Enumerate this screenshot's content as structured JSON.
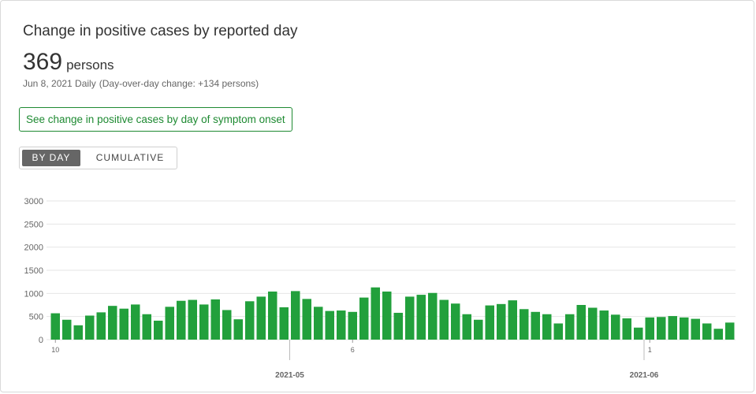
{
  "header": {
    "title": "Change in positive cases by reported day",
    "value": "369",
    "unit": "persons",
    "date_line": "Jun 8, 2021 Daily",
    "change_line": "(Day-over-day change: +134 persons)"
  },
  "link_button": {
    "label": "See change in positive cases by day of symptom onset"
  },
  "toggle": {
    "by_day": "BY DAY",
    "cumulative": "CUMULATIVE",
    "selected": "BY DAY"
  },
  "colors": {
    "bar": "#22a03c",
    "link": "#1e8a32",
    "grid": "#e6e6e6"
  },
  "chart_data": {
    "type": "bar",
    "x_start": "2021-04-10",
    "x_end": "2021-06-08",
    "x_ticks": [
      {
        "date": "2021-04-10",
        "label": "10",
        "kind": "day"
      },
      {
        "date": "2021-05-06",
        "label": "6",
        "kind": "day"
      },
      {
        "date": "2021-06-01",
        "label": "1",
        "kind": "day"
      },
      {
        "date": "2021-05-01",
        "label": "2021-05",
        "kind": "month"
      },
      {
        "date": "2021-06-01",
        "label": "2021-06",
        "kind": "month"
      }
    ],
    "y_ticks": [
      0,
      500,
      1000,
      1500,
      2000,
      2500,
      3000
    ],
    "ylim": [
      0,
      3000
    ],
    "grid": true,
    "values": [
      570,
      430,
      310,
      520,
      590,
      730,
      670,
      760,
      550,
      410,
      710,
      840,
      860,
      760,
      870,
      640,
      440,
      830,
      930,
      1040,
      700,
      1050,
      880,
      710,
      620,
      630,
      600,
      910,
      1130,
      1040,
      580,
      930,
      970,
      1010,
      860,
      780,
      550,
      430,
      740,
      770,
      850,
      660,
      600,
      550,
      350,
      550,
      750,
      690,
      630,
      540,
      460,
      260,
      480,
      490,
      510,
      480,
      450,
      350,
      235,
      369
    ]
  }
}
